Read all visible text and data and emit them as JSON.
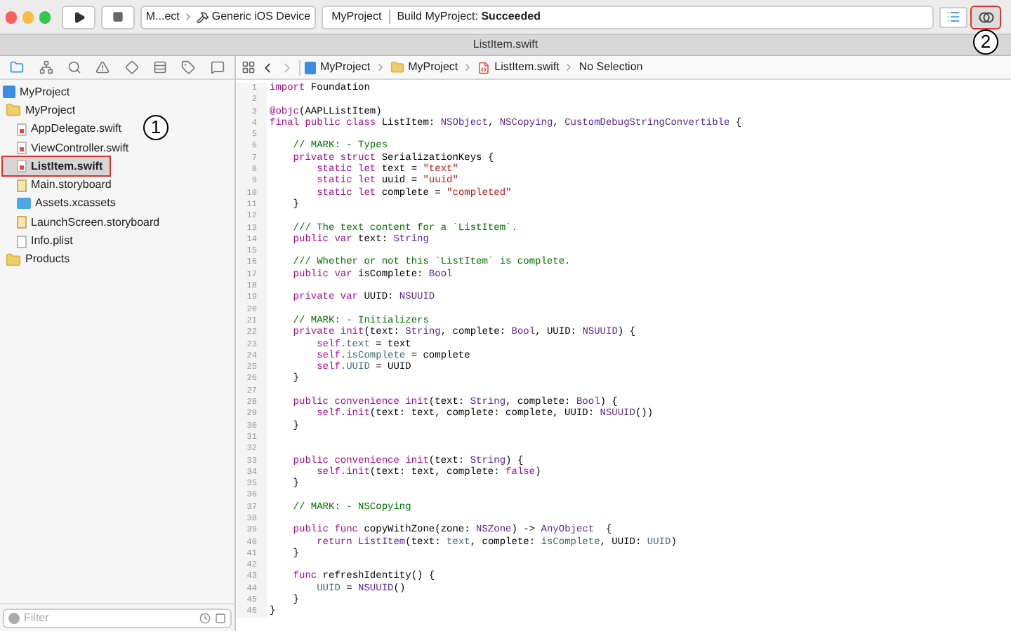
{
  "toolbar": {
    "scheme": "M...ect",
    "destination": "Generic iOS Device",
    "activity": {
      "project": "MyProject",
      "status": "Build MyProject: **Succeeded**"
    },
    "editor_modes": [
      {
        "kind": "standard",
        "selected": false,
        "highlighted": false
      },
      {
        "kind": "assistant",
        "selected": true,
        "highlighted": true,
        "callout": "2"
      }
    ]
  },
  "tab": {
    "title": "ListItem.swift"
  },
  "jump_bar": [
    "MyProject",
    "MyProject",
    "ListItem.swift",
    "No Selection"
  ],
  "navigator": {
    "items": [
      {
        "name": "MyProject",
        "kind": "project",
        "selected": false,
        "highlighted": false,
        "children": [
          {
            "name": "MyProject",
            "kind": "folder",
            "selected": false,
            "highlighted": false,
            "children": [
              {
                "name": "AppDelegate.swift",
                "kind": "swift",
                "selected": false,
                "highlighted": false
              },
              {
                "name": "ViewController.swift",
                "kind": "swift",
                "selected": false,
                "highlighted": false
              },
              {
                "name": "ListItem.swift",
                "kind": "swift",
                "selected": true,
                "highlighted": true,
                "callout": "1"
              },
              {
                "name": "Main.storyboard",
                "kind": "storyboard",
                "selected": false,
                "highlighted": false
              },
              {
                "name": "Assets.xcassets",
                "kind": "assets",
                "selected": false,
                "highlighted": false
              },
              {
                "name": "LaunchScreen.storyboard",
                "kind": "storyboard",
                "selected": false,
                "highlighted": false
              },
              {
                "name": "Info.plist",
                "kind": "plist",
                "selected": false,
                "highlighted": false
              }
            ]
          },
          {
            "name": "Products",
            "kind": "folder",
            "selected": false,
            "highlighted": false
          }
        ]
      }
    ],
    "filter": {
      "placeholder": "Filter"
    }
  },
  "code": [
    {
      "n": "1",
      "tokens": [
        {
          "kind": "kw",
          "text": "import"
        },
        {
          "kind": "plain",
          "text": " Foundation"
        }
      ]
    },
    {
      "n": "2"
    },
    {
      "n": "3",
      "tokens": [
        {
          "kind": "kw",
          "text": "@objc"
        },
        {
          "kind": "plain",
          "text": "(AAPLListItem)"
        }
      ]
    },
    {
      "n": "4",
      "tokens": [
        {
          "kind": "kw",
          "text": "final public class"
        },
        {
          "kind": "plain",
          "text": " ListItem: "
        },
        {
          "kind": "type",
          "text": "NSObject"
        },
        {
          "kind": "plain",
          "text": ", "
        },
        {
          "kind": "type",
          "text": "NSCopying"
        },
        {
          "kind": "plain",
          "text": ", "
        },
        {
          "kind": "type",
          "text": "CustomDebugStringConvertible"
        },
        {
          "kind": "plain",
          "text": " {"
        }
      ]
    },
    {
      "n": "5"
    },
    {
      "n": "6",
      "tokens": [
        {
          "kind": "comment",
          "text": "    // MARK: - Types"
        }
      ]
    },
    {
      "n": "7",
      "tokens": [
        {
          "kind": "kw",
          "text": "    private struct"
        },
        {
          "kind": "plain",
          "text": " SerializationKeys {"
        }
      ]
    },
    {
      "n": "8",
      "tokens": [
        {
          "kind": "kw",
          "text": "        static let"
        },
        {
          "kind": "plain",
          "text": " text = "
        },
        {
          "kind": "str",
          "text": "\"text\""
        }
      ]
    },
    {
      "n": "9",
      "tokens": [
        {
          "kind": "kw",
          "text": "        static let"
        },
        {
          "kind": "plain",
          "text": " uuid = "
        },
        {
          "kind": "str",
          "text": "\"uuid\""
        }
      ]
    },
    {
      "n": "10",
      "tokens": [
        {
          "kind": "kw",
          "text": "        static let"
        },
        {
          "kind": "plain",
          "text": " complete = "
        },
        {
          "kind": "str",
          "text": "\"completed\""
        }
      ]
    },
    {
      "n": "11",
      "tokens": [
        {
          "kind": "plain",
          "text": "    }"
        }
      ]
    },
    {
      "n": "12"
    },
    {
      "n": "13",
      "tokens": [
        {
          "kind": "comment",
          "text": "    /// The text content for a `ListItem`."
        }
      ]
    },
    {
      "n": "14",
      "tokens": [
        {
          "kind": "kw",
          "text": "    public var"
        },
        {
          "kind": "plain",
          "text": " text: "
        },
        {
          "kind": "type",
          "text": "String"
        }
      ]
    },
    {
      "n": "15"
    },
    {
      "n": "16",
      "tokens": [
        {
          "kind": "comment",
          "text": "    /// Whether or not this `ListItem` is complete."
        }
      ]
    },
    {
      "n": "17",
      "tokens": [
        {
          "kind": "kw",
          "text": "    public var"
        },
        {
          "kind": "plain",
          "text": " isComplete: "
        },
        {
          "kind": "type",
          "text": "Bool"
        }
      ]
    },
    {
      "n": "18"
    },
    {
      "n": "19",
      "tokens": [
        {
          "kind": "kw",
          "text": "    private var"
        },
        {
          "kind": "plain",
          "text": " UUID: "
        },
        {
          "kind": "type",
          "text": "NSUUID"
        }
      ]
    },
    {
      "n": "20"
    },
    {
      "n": "21",
      "tokens": [
        {
          "kind": "comment",
          "text": "    // MARK: - Initializers"
        }
      ]
    },
    {
      "n": "22",
      "tokens": [
        {
          "kind": "kw",
          "text": "    private init"
        },
        {
          "kind": "plain",
          "text": "(text: "
        },
        {
          "kind": "type",
          "text": "String"
        },
        {
          "kind": "plain",
          "text": ", complete: "
        },
        {
          "kind": "type",
          "text": "Bool"
        },
        {
          "kind": "plain",
          "text": ", UUID: "
        },
        {
          "kind": "type",
          "text": "NSUUID"
        },
        {
          "kind": "plain",
          "text": ") {"
        }
      ]
    },
    {
      "n": "23",
      "tokens": [
        {
          "kind": "kw",
          "text": "        self."
        },
        {
          "kind": "prop",
          "text": "text"
        },
        {
          "kind": "plain",
          "text": " = text"
        }
      ]
    },
    {
      "n": "24",
      "tokens": [
        {
          "kind": "kw",
          "text": "        self."
        },
        {
          "kind": "prop",
          "text": "isComplete"
        },
        {
          "kind": "plain",
          "text": " = complete"
        }
      ]
    },
    {
      "n": "25",
      "tokens": [
        {
          "kind": "kw",
          "text": "        self."
        },
        {
          "kind": "prop",
          "text": "UUID"
        },
        {
          "kind": "plain",
          "text": " = UUID"
        }
      ]
    },
    {
      "n": "26",
      "tokens": [
        {
          "kind": "plain",
          "text": "    }"
        }
      ]
    },
    {
      "n": "27"
    },
    {
      "n": "28",
      "tokens": [
        {
          "kind": "kw",
          "text": "    public convenience init"
        },
        {
          "kind": "plain",
          "text": "(text: "
        },
        {
          "kind": "type",
          "text": "String"
        },
        {
          "kind": "plain",
          "text": ", complete: "
        },
        {
          "kind": "type",
          "text": "Bool"
        },
        {
          "kind": "plain",
          "text": ") {"
        }
      ]
    },
    {
      "n": "29",
      "tokens": [
        {
          "kind": "kw",
          "text": "        self.init"
        },
        {
          "kind": "plain",
          "text": "(text: text, complete: complete, UUID: "
        },
        {
          "kind": "type",
          "text": "NSUUID"
        },
        {
          "kind": "plain",
          "text": "())"
        }
      ]
    },
    {
      "n": "30",
      "tokens": [
        {
          "kind": "plain",
          "text": "    }"
        }
      ]
    },
    {
      "n": "31"
    },
    {
      "n": "32"
    },
    {
      "n": "33",
      "tokens": [
        {
          "kind": "kw",
          "text": "    public convenience init"
        },
        {
          "kind": "plain",
          "text": "(text: "
        },
        {
          "kind": "type",
          "text": "String"
        },
        {
          "kind": "plain",
          "text": ") {"
        }
      ]
    },
    {
      "n": "34",
      "tokens": [
        {
          "kind": "kw",
          "text": "        self.init"
        },
        {
          "kind": "plain",
          "text": "(text: text, complete: "
        },
        {
          "kind": "kw",
          "text": "false"
        },
        {
          "kind": "plain",
          "text": ")"
        }
      ]
    },
    {
      "n": "35",
      "tokens": [
        {
          "kind": "plain",
          "text": "    }"
        }
      ]
    },
    {
      "n": "36"
    },
    {
      "n": "37",
      "tokens": [
        {
          "kind": "comment",
          "text": "    // MARK: - NSCopying"
        }
      ]
    },
    {
      "n": "38"
    },
    {
      "n": "39",
      "tokens": [
        {
          "kind": "kw",
          "text": "    public func"
        },
        {
          "kind": "plain",
          "text": " copyWithZone(zone: "
        },
        {
          "kind": "type",
          "text": "NSZone"
        },
        {
          "kind": "plain",
          "text": ") -> "
        },
        {
          "kind": "type",
          "text": "AnyObject"
        },
        {
          "kind": "plain",
          "text": "  {"
        }
      ]
    },
    {
      "n": "40",
      "tokens": [
        {
          "kind": "kw",
          "text": "        return "
        },
        {
          "kind": "type",
          "text": "ListItem"
        },
        {
          "kind": "plain",
          "text": "(text: "
        },
        {
          "kind": "prop",
          "text": "text"
        },
        {
          "kind": "plain",
          "text": ", complete: "
        },
        {
          "kind": "prop",
          "text": "isComplete"
        },
        {
          "kind": "plain",
          "text": ", UUID: "
        },
        {
          "kind": "prop",
          "text": "UUID"
        },
        {
          "kind": "plain",
          "text": ")"
        }
      ]
    },
    {
      "n": "41",
      "tokens": [
        {
          "kind": "plain",
          "text": "    }"
        }
      ]
    },
    {
      "n": "42"
    },
    {
      "n": "43",
      "tokens": [
        {
          "kind": "kw",
          "text": "    func"
        },
        {
          "kind": "plain",
          "text": " refreshIdentity() {"
        }
      ]
    },
    {
      "n": "44",
      "tokens": [
        {
          "kind": "prop",
          "text": "        UUID"
        },
        {
          "kind": "plain",
          "text": " = "
        },
        {
          "kind": "type",
          "text": "NSUUID"
        },
        {
          "kind": "plain",
          "text": "()"
        }
      ]
    },
    {
      "n": "45",
      "tokens": [
        {
          "kind": "plain",
          "text": "    }"
        }
      ]
    },
    {
      "n": "46",
      "tokens": [
        {
          "kind": "plain",
          "text": "}"
        }
      ]
    }
  ]
}
